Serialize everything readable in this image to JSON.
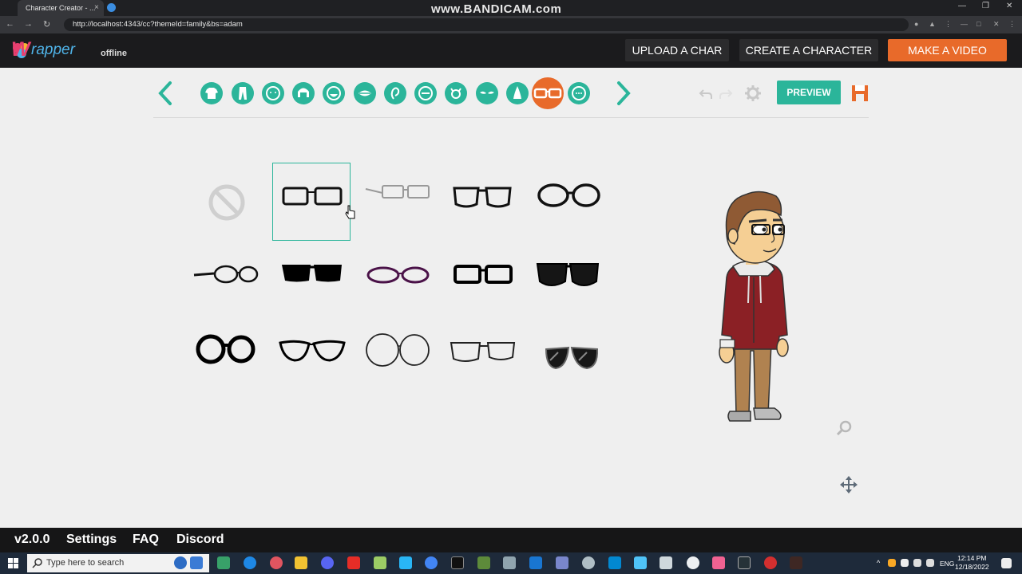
{
  "browser": {
    "tab_title": "Character Creator - ...",
    "tab_close": "×",
    "url": "http://localhost:4343/cc?themeId=family&bs=adam",
    "recorder_watermark": "www.BANDICAM.com",
    "window_controls": [
      "—",
      "❐",
      "✕"
    ]
  },
  "header": {
    "logo_initial": "W",
    "logo_text": "rapper",
    "logo_subtext": "offline",
    "upload_label": "UPLOAD A CHAR",
    "create_label": "CREATE A CHARACTER",
    "video_label": "MAKE A VIDEO",
    "accent_color": "#e86a2a"
  },
  "toolbar": {
    "categories": [
      "shirt-icon",
      "pants-icon",
      "head-icon",
      "hair-icon",
      "beard-icon",
      "mouth-icon",
      "ear-icon",
      "eyebrow-icon",
      "eye-icon",
      "eyebrows-icon",
      "nose-icon",
      "glasses-icon",
      "face-detail-icon"
    ],
    "active_category": "glasses-icon",
    "preview_label": "PREVIEW",
    "primary_color": "#2bb59a"
  },
  "glasses_grid": {
    "selected_index": 1,
    "items": [
      "none",
      "rectangle-thin",
      "rimless-wire",
      "square-thick",
      "round-thick",
      "small-round-wire",
      "solid-black-rect",
      "purple-oval",
      "black-rect",
      "dark-sunglasses",
      "thick-round",
      "cat-eye",
      "large-round-thin",
      "wire-rect",
      "aviator-sunglasses"
    ]
  },
  "footer": {
    "version": "v2.0.0",
    "settings": "Settings",
    "faq": "FAQ",
    "discord": "Discord"
  },
  "taskbar": {
    "search_placeholder": "Type here to search",
    "language": "ENG",
    "time": "12:14 PM",
    "date": "12/18/2022"
  }
}
